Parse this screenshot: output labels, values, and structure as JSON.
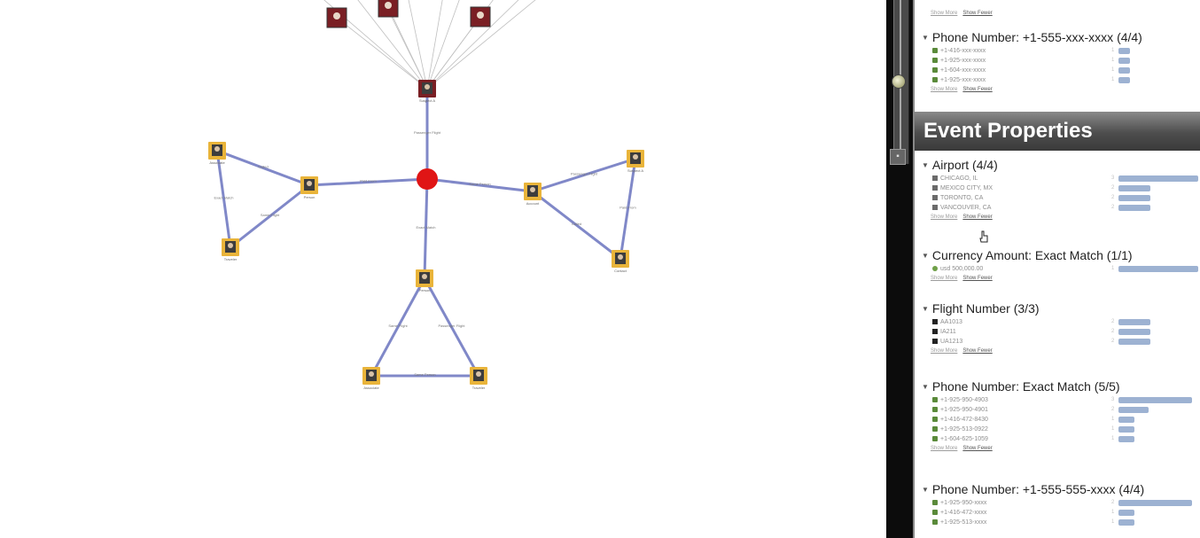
{
  "colors": {
    "edge": "#8088c8",
    "fan_edge": "#bfbfbf",
    "hub": "#e01515",
    "node_border": "#e9b43a",
    "node_dark": "#7a1f24",
    "bar": "#9db2d2"
  },
  "graph": {
    "edge_labels": [
      "Passenger Flight",
      "Paid From",
      "Called",
      "Exact Match",
      "Same Flight",
      "Same Person"
    ],
    "node_labels": [
      "Suspect A",
      "Contact",
      "Person",
      "Associate",
      "Traveler",
      "Account"
    ]
  },
  "panel": {
    "top_links": {
      "show_more": "Show More",
      "show_fewer": "Show Fewer"
    },
    "group_phone_pattern": {
      "title": "Phone Number: +1-555-xxx-xxxx (4/4)",
      "rows": [
        {
          "icon": "phone-icon",
          "label": "+1-416-xxx-xxxx",
          "count": "1",
          "fraction": 0.14
        },
        {
          "icon": "phone-icon",
          "label": "+1-925-xxx-xxxx",
          "count": "1",
          "fraction": 0.14
        },
        {
          "icon": "phone-icon",
          "label": "+1-604-xxx-xxxx",
          "count": "1",
          "fraction": 0.14
        },
        {
          "icon": "phone-icon",
          "label": "+1-925-xxx-xxxx",
          "count": "1",
          "fraction": 0.14
        }
      ],
      "show_more": "Show More",
      "show_fewer": "Show Fewer"
    },
    "event_header": "Event Properties",
    "group_airport": {
      "title": "Airport (4/4)",
      "rows": [
        {
          "icon": "airport-icon",
          "label": "CHICAGO, IL",
          "count": "3",
          "fraction": 1.0
        },
        {
          "icon": "airport-icon",
          "label": "MEXICO CITY, MX",
          "count": "2",
          "fraction": 0.4
        },
        {
          "icon": "airport-icon",
          "label": "TORONTO, CA",
          "count": "2",
          "fraction": 0.4
        },
        {
          "icon": "airport-icon",
          "label": "VANCOUVER, CA",
          "count": "2",
          "fraction": 0.4
        }
      ],
      "show_more": "Show More",
      "show_fewer": "Show Fewer"
    },
    "group_currency": {
      "title": "Currency Amount: Exact Match (1/1)",
      "rows": [
        {
          "icon": "money-icon",
          "label": "usd 500,000.00",
          "count": "1",
          "fraction": 1.0
        }
      ],
      "show_more": "Show More",
      "show_fewer": "Show Fewer"
    },
    "group_flight": {
      "title": "Flight Number (3/3)",
      "rows": [
        {
          "icon": "flight-icon",
          "label": "AA1013",
          "count": "2",
          "fraction": 0.4
        },
        {
          "icon": "flight-icon",
          "label": "IA211",
          "count": "2",
          "fraction": 0.4
        },
        {
          "icon": "flight-icon",
          "label": "UA1213",
          "count": "2",
          "fraction": 0.4
        }
      ],
      "show_more": "Show More",
      "show_fewer": "Show Fewer"
    },
    "group_phone_exact": {
      "title": "Phone Number: Exact Match (5/5)",
      "rows": [
        {
          "icon": "phone-icon",
          "label": "+1-925-950-4903",
          "count": "3",
          "fraction": 0.92
        },
        {
          "icon": "phone-icon",
          "label": "+1-925-950-4901",
          "count": "2",
          "fraction": 0.38
        },
        {
          "icon": "phone-icon",
          "label": "+1-416-472-8430",
          "count": "1",
          "fraction": 0.2
        },
        {
          "icon": "phone-icon",
          "label": "+1-925-513-0922",
          "count": "1",
          "fraction": 0.2
        },
        {
          "icon": "phone-icon",
          "label": "+1-604-625-1059",
          "count": "1",
          "fraction": 0.2
        }
      ],
      "show_more": "Show More",
      "show_fewer": "Show Fewer"
    },
    "group_phone_555": {
      "title": "Phone Number: +1-555-555-xxxx (4/4)",
      "rows": [
        {
          "icon": "phone-icon",
          "label": "+1-925-950-xxxx",
          "count": "2",
          "fraction": 0.92
        },
        {
          "icon": "phone-icon",
          "label": "+1-416-472-xxxx",
          "count": "1",
          "fraction": 0.2
        },
        {
          "icon": "phone-icon",
          "label": "+1-925-513-xxxx",
          "count": "1",
          "fraction": 0.2
        }
      ]
    }
  }
}
